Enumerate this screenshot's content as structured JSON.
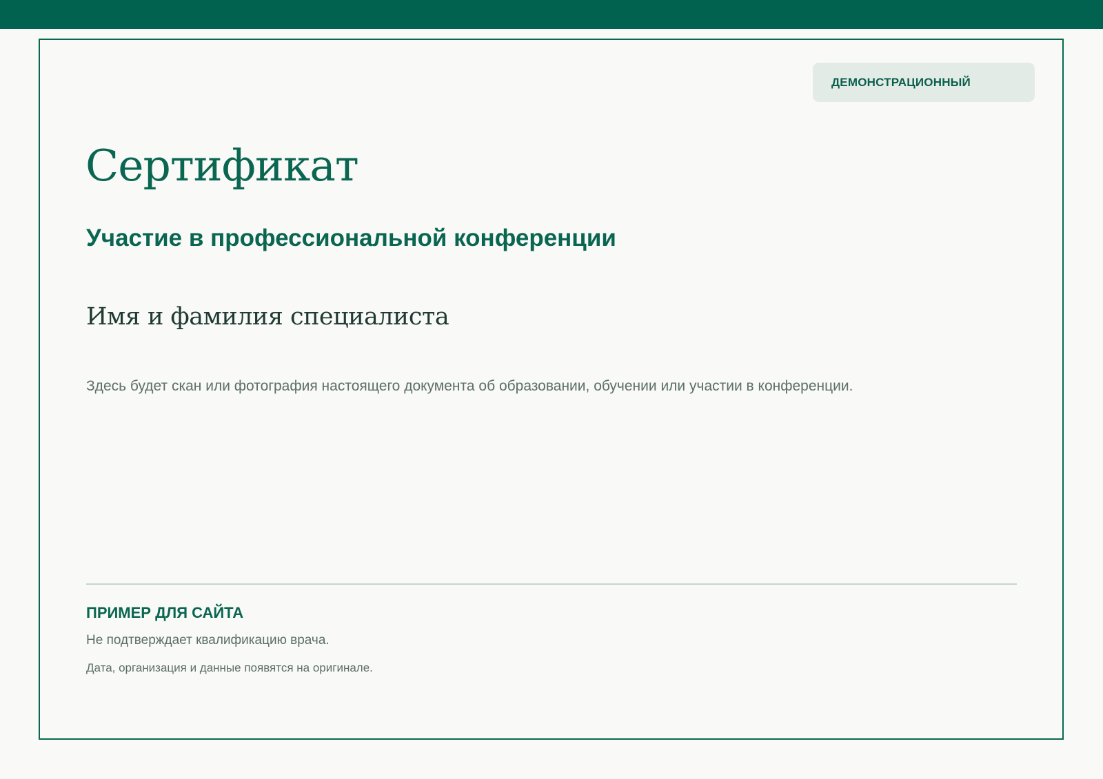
{
  "colors": {
    "accent": "#00624f",
    "page_background": "#f9f9f7",
    "badge_background": "#e3ebe6",
    "body_text": "#5c6f68",
    "name_text": "#1f3a33",
    "divider": "#c8d5d0"
  },
  "badge": {
    "label": "ДЕМОНСТРАЦИОННЫЙ"
  },
  "certificate": {
    "title": "Сертификат",
    "subtitle": "Участие в профессиональной конференции",
    "specialist_name": "Имя и фамилия специалиста",
    "description": "Здесь будет скан или фотография настоящего документа об образовании, обучении или участии в конференции."
  },
  "footer": {
    "heading": "ПРИМЕР ДЛЯ САЙТА",
    "disclaimer": "Не подтверждает квалификацию врача.",
    "note": "Дата, организация и данные появятся на оригинале."
  }
}
